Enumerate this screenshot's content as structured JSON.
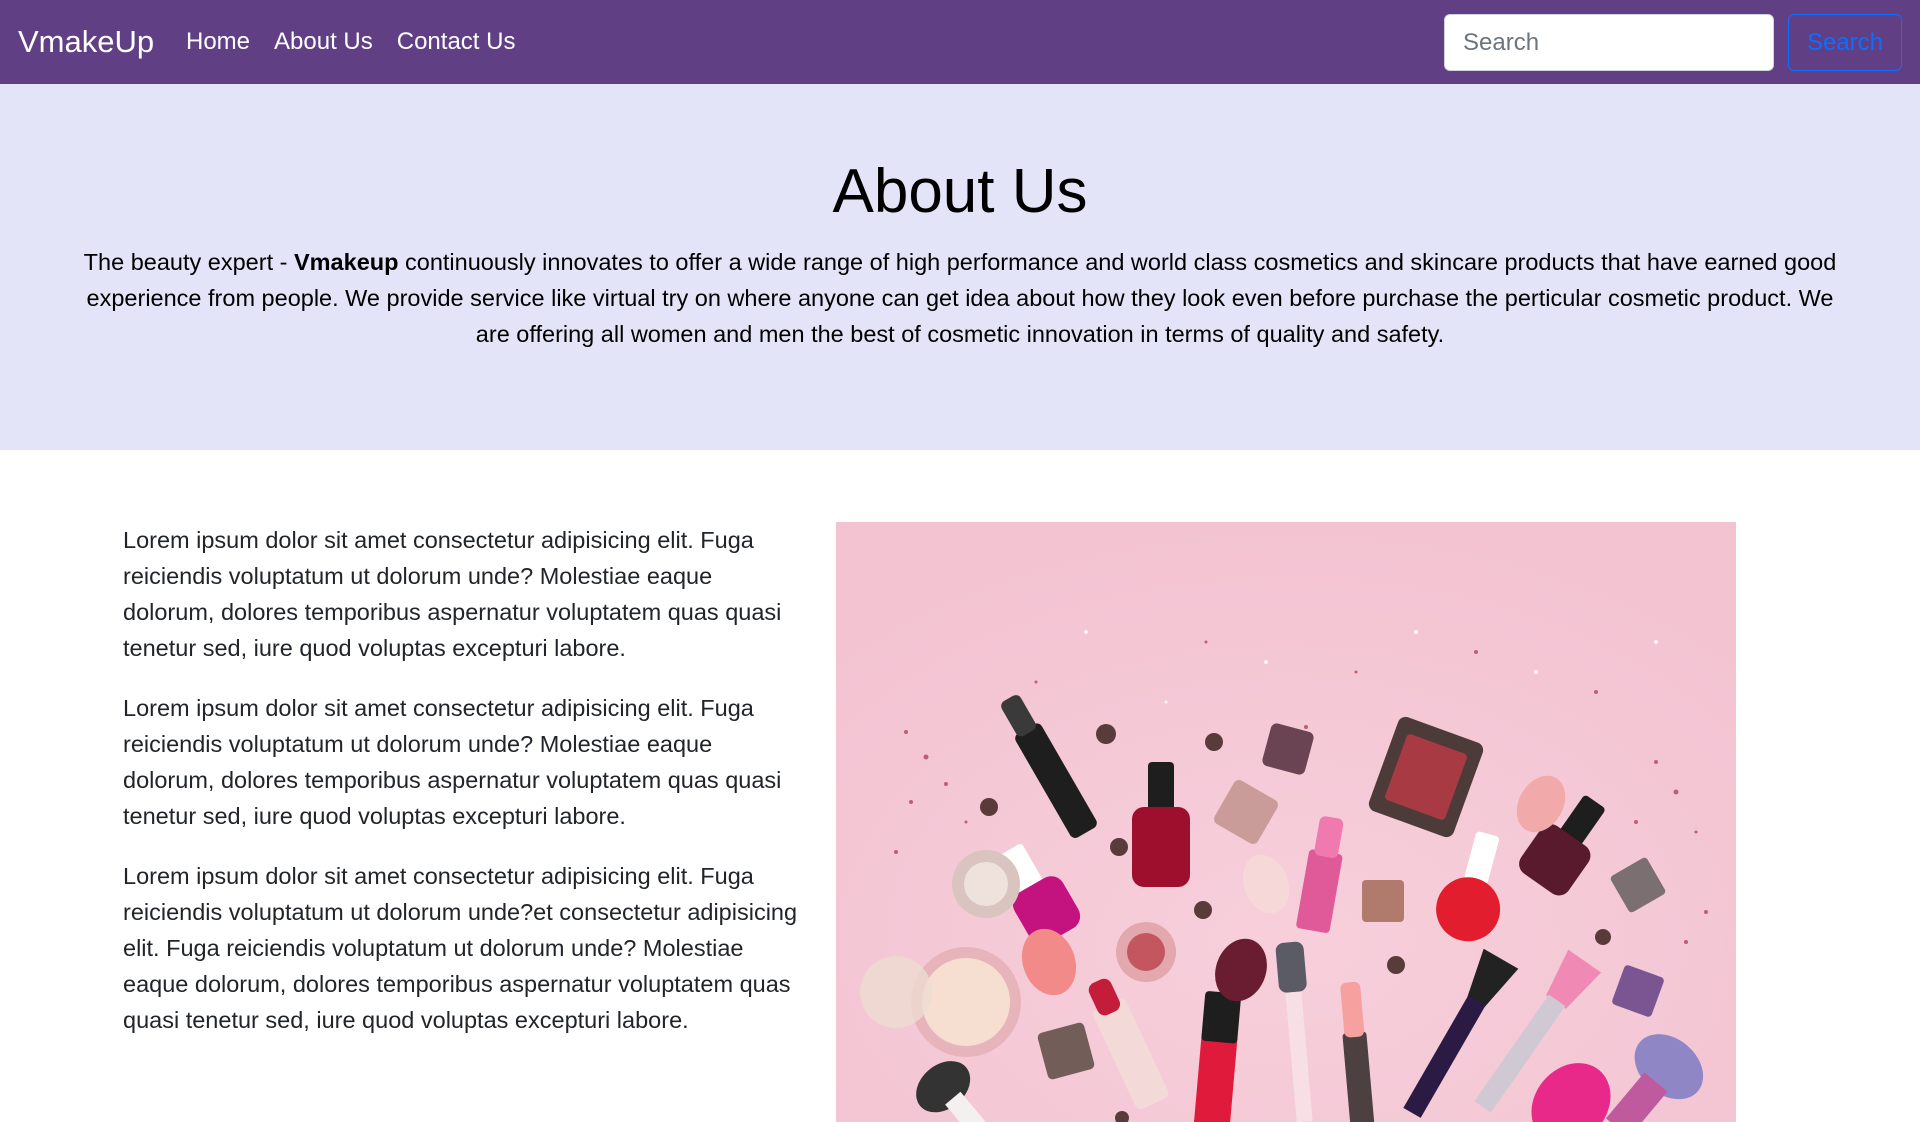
{
  "navbar": {
    "brand": "VmakeUp",
    "links": [
      "Home",
      "About Us",
      "Contact Us"
    ],
    "search_placeholder": "Search",
    "search_button": "Search"
  },
  "hero": {
    "title": "About Us",
    "text_before": "The beauty expert - ",
    "text_bold": "Vmakeup",
    "text_after": " continuously innovates to offer a wide range of high performance and world class cosmetics and skincare products that have earned good experience from people. We provide service like virtual try on where anyone can get idea about how they look even before purchase the perticular cosmetic product. We are offering all women and men the best of cosmetic innovation in terms of quality and safety."
  },
  "content": {
    "paragraphs": [
      "Lorem ipsum dolor sit amet consectetur adipisicing elit. Fuga reiciendis voluptatum ut dolorum unde? Molestiae eaque dolorum, dolores temporibus aspernatur voluptatem quas quasi tenetur sed, iure quod voluptas excepturi labore.",
      "Lorem ipsum dolor sit amet consectetur adipisicing elit. Fuga reiciendis voluptatum ut dolorum unde? Molestiae eaque dolorum, dolores temporibus aspernatur voluptatem quas quasi tenetur sed, iure quod voluptas excepturi labore.",
      "Lorem ipsum dolor sit amet consectetur adipisicing elit. Fuga reiciendis voluptatum ut dolorum unde?et consectetur adipisicing elit. Fuga reiciendis voluptatum ut dolorum unde? Molestiae eaque dolorum, dolores temporibus aspernatur voluptatem quas quasi tenetur sed, iure quod voluptas excepturi labore."
    ],
    "image_icon": "cosmetics-flatlay-image"
  },
  "colors": {
    "navbar_bg": "#613f85",
    "hero_bg": "#e4e4f8",
    "search_button": "#0d6efd",
    "photo_bg": "#f5c9d6"
  }
}
